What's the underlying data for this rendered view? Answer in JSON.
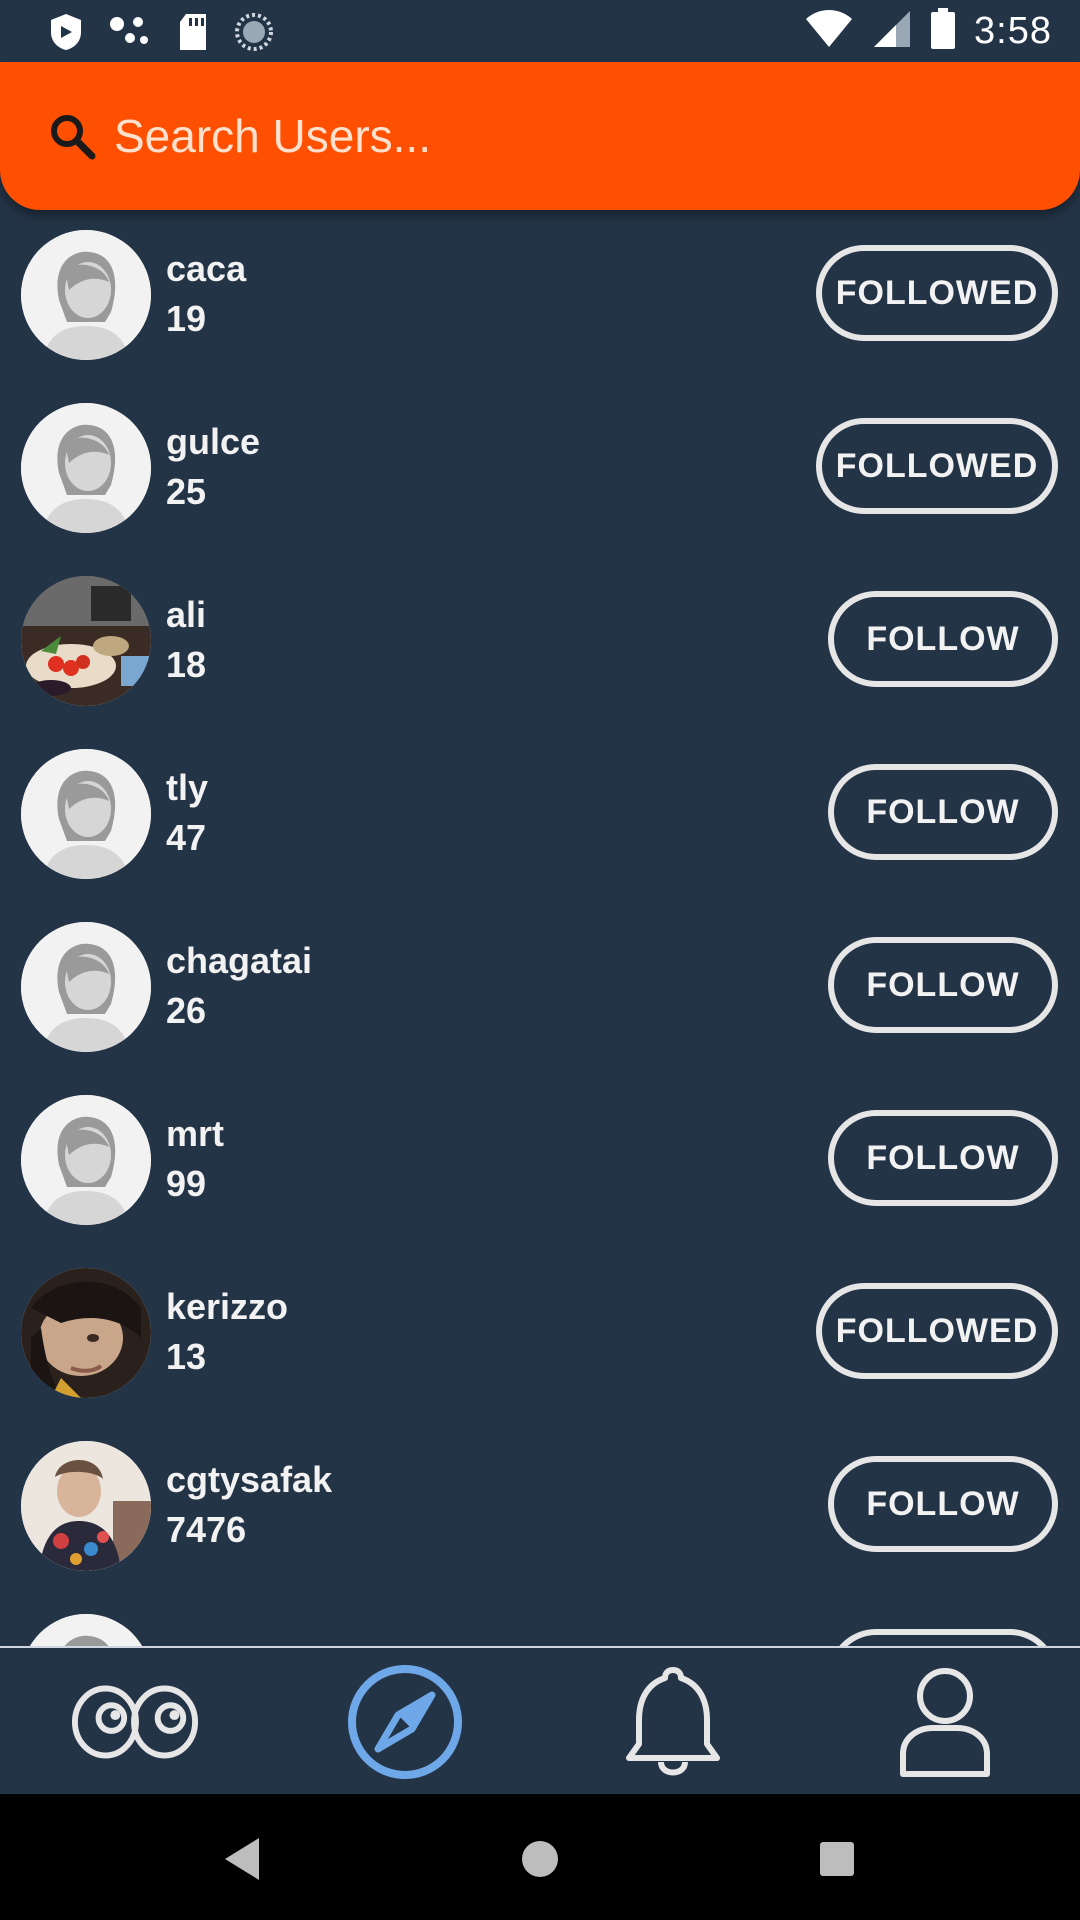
{
  "status_bar": {
    "time": "3:58",
    "icons": [
      "shield-icon",
      "dots-icon",
      "sd-card-icon",
      "sync-icon",
      "wifi-icon",
      "signal-icon",
      "battery-icon"
    ]
  },
  "search": {
    "placeholder": "Search Users...",
    "value": ""
  },
  "colors": {
    "background": "#243447",
    "search_bar": "#FF4F00",
    "active_nav": "#6FA8E8",
    "text": "#F2F2F2"
  },
  "users": [
    {
      "name": "caca",
      "count": "19",
      "button": "FOLLOWED",
      "avatar": "default-avatar"
    },
    {
      "name": "gulce",
      "count": "25",
      "button": "FOLLOWED",
      "avatar": "default-avatar"
    },
    {
      "name": "ali",
      "count": "18",
      "button": "FOLLOW",
      "avatar": "food-photo"
    },
    {
      "name": "tly",
      "count": "47",
      "button": "FOLLOW",
      "avatar": "default-avatar"
    },
    {
      "name": "chagatai",
      "count": "26",
      "button": "FOLLOW",
      "avatar": "default-avatar"
    },
    {
      "name": "mrt",
      "count": "99",
      "button": "FOLLOW",
      "avatar": "default-avatar"
    },
    {
      "name": "kerizzo",
      "count": "13",
      "button": "FOLLOWED",
      "avatar": "person-photo"
    },
    {
      "name": "cgtysafak",
      "count": "7476",
      "button": "FOLLOW",
      "avatar": "person-photo"
    },
    {
      "name": "",
      "count": "",
      "button": "",
      "avatar": "default-avatar"
    }
  ],
  "bottom_nav": {
    "items": [
      "eyes-icon",
      "compass-icon",
      "bell-icon",
      "profile-icon"
    ],
    "active": "compass-icon"
  },
  "system_nav": [
    "back-icon",
    "home-icon",
    "recents-icon"
  ]
}
